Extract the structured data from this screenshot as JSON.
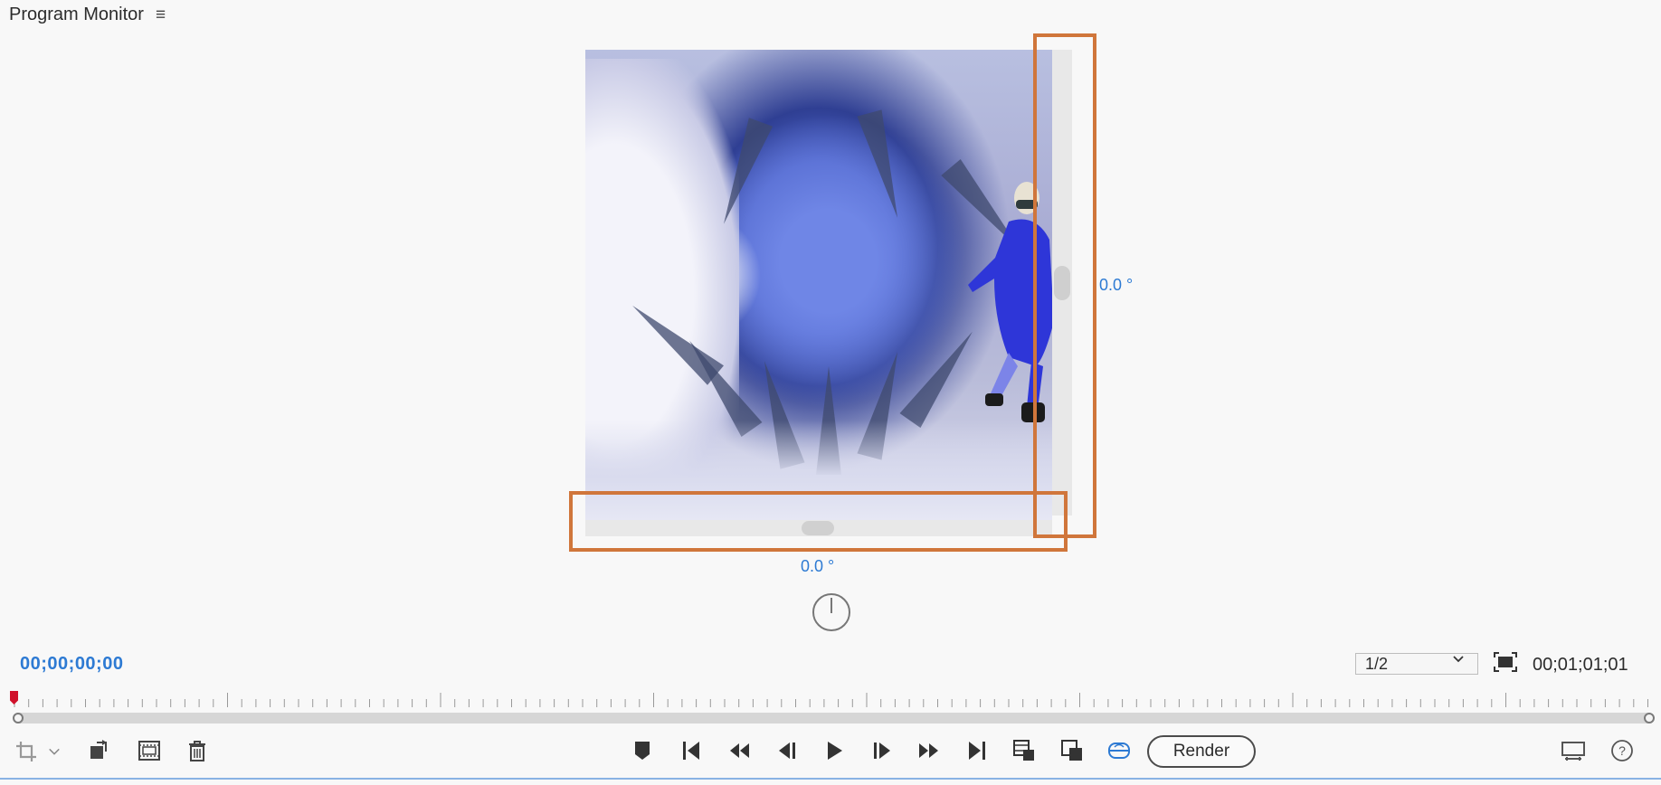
{
  "panel": {
    "title": "Program Monitor",
    "menu_icon": "hamburger-menu-icon"
  },
  "viewer": {
    "horizontal_angle": "0.0 °",
    "vertical_angle": "0.0 °",
    "highlight_color": "#d0763b"
  },
  "timecode": {
    "current": "00;00;00;00",
    "duration": "00;01;01;01",
    "current_color": "#2d7ad3"
  },
  "resolution": {
    "selected": "1/2"
  },
  "toolbar": {
    "render_label": "Render",
    "left_icons": [
      "crop-icon",
      "chevron-down-icon",
      "export-frame-icon",
      "safe-margins-icon",
      "trash-icon"
    ],
    "center_icons": [
      "marker-icon",
      "go-to-in-icon",
      "step-back-icon",
      "step-back-frame-icon",
      "play-icon",
      "step-forward-frame-icon",
      "step-forward-icon",
      "go-to-out-icon",
      "insert-icon",
      "overwrite-icon",
      "vr-video-icon"
    ],
    "right_icons": [
      "comparison-view-icon",
      "help-icon"
    ]
  }
}
